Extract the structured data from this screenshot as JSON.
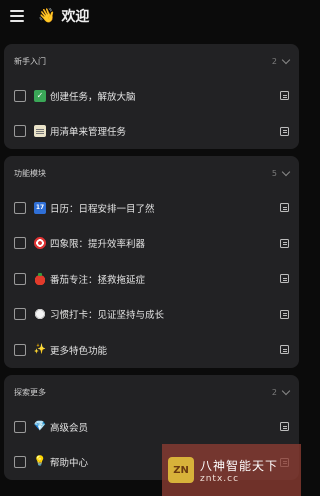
{
  "header": {
    "title_emoji": "👋",
    "title": "欢迎"
  },
  "sections": [
    {
      "title": "新手入门",
      "count": "2",
      "tasks": [
        {
          "emoji": "✓",
          "text": "创建任务，解放大脑"
        },
        {
          "emoji": "",
          "text": "用清单来管理任务"
        }
      ]
    },
    {
      "title": "功能模块",
      "count": "5",
      "tasks": [
        {
          "emoji": "17",
          "text": "日历：日程安排一目了然"
        },
        {
          "emoji": "",
          "text": "四象限：提升效率利器"
        },
        {
          "emoji": "",
          "text": "番茄专注：拯救拖延症"
        },
        {
          "emoji": "",
          "text": "习惯打卡：见证坚持与成长"
        },
        {
          "emoji": "✨",
          "text": "更多特色功能"
        }
      ]
    },
    {
      "title": "探索更多",
      "count": "2",
      "tasks": [
        {
          "emoji": "💎",
          "text": "高级会员"
        },
        {
          "emoji": "💡",
          "text": "帮助中心"
        }
      ]
    }
  ],
  "icons": {
    "menu": "hamburger-icon",
    "chevron": "chevron-down-icon",
    "note": "note-icon"
  },
  "watermark": {
    "line1": "八神智能天下",
    "line2": "zntx.cc",
    "logo": "ZN"
  },
  "colors": {
    "background": "#0b0b0b",
    "card": "#222224",
    "watermark": "#8c3c32"
  }
}
